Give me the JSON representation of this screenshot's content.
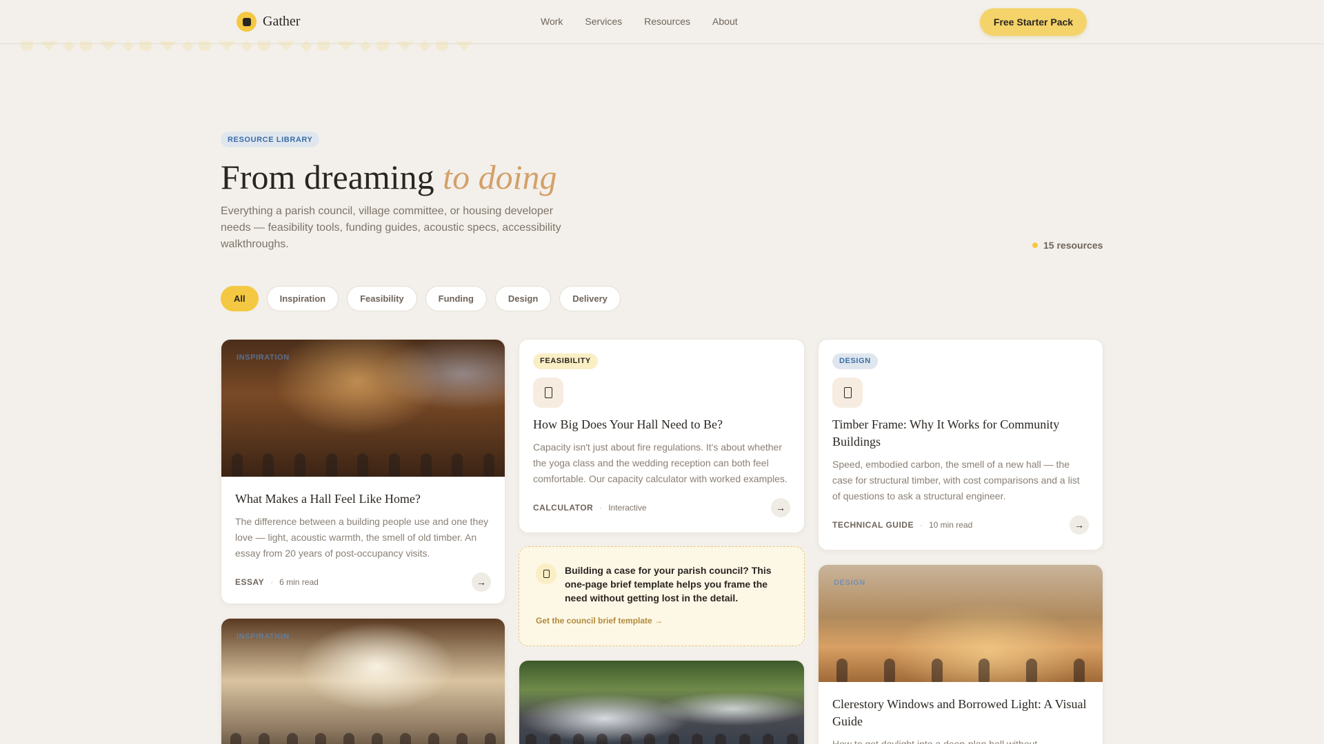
{
  "header": {
    "brand": "Gather",
    "nav": [
      "Work",
      "Services",
      "Resources",
      "About"
    ],
    "cta": "Free Starter Pack"
  },
  "hero": {
    "eyebrow": "RESOURCE LIBRARY",
    "title_main": "From dreaming",
    "title_accent": "to doing",
    "lede": "Everything a parish council, village committee, or housing developer needs — feasibility tools, funding guides, acoustic specs, accessibility walkthroughs.",
    "count": "15 resources"
  },
  "filters": [
    "All",
    "Inspiration",
    "Feasibility",
    "Funding",
    "Design",
    "Delivery"
  ],
  "cards": {
    "home": {
      "image_tag": "INSPIRATION",
      "title": "What Makes a Hall Feel Like Home?",
      "desc": "The difference between a building people use and one they love — light, acoustic warmth, the smell of old timber. An essay from 20 years of post-occupancy visits.",
      "kind": "ESSAY",
      "detail": "6 min read"
    },
    "capacity": {
      "tag": "FEASIBILITY",
      "title": "How Big Does Your Hall Need to Be?",
      "desc": "Capacity isn't just about fire regulations. It's about whether the yoga class and the wedding reception can both feel comfortable. Our capacity calculator with worked examples.",
      "kind": "CALCULATOR",
      "detail": "Interactive"
    },
    "timber": {
      "tag": "DESIGN",
      "title": "Timber Frame: Why It Works for Community Buildings",
      "desc": "Speed, embodied carbon, the smell of a new hall — the case for structural timber, with cost comparisons and a list of questions to ask a structural engineer.",
      "kind": "TECHNICAL GUIDE",
      "detail": "10 min read"
    },
    "promo": {
      "text": "Building a case for your parish council? This one-page brief template helps you frame the need without getting lost in the detail.",
      "link": "Get the council brief template"
    },
    "yoga": {
      "image_tag": "INSPIRATION"
    },
    "clerestory": {
      "image_tag": "DESIGN",
      "title": "Clerestory Windows and Borrowed Light: A Visual Guide",
      "desc": "How to get daylight into a deep-plan hall without"
    }
  },
  "icons": {
    "arrow": "→"
  },
  "colors": {
    "accent": "#f4c842",
    "accent_text": "#d4a06a",
    "link": "#3b6ea5"
  }
}
